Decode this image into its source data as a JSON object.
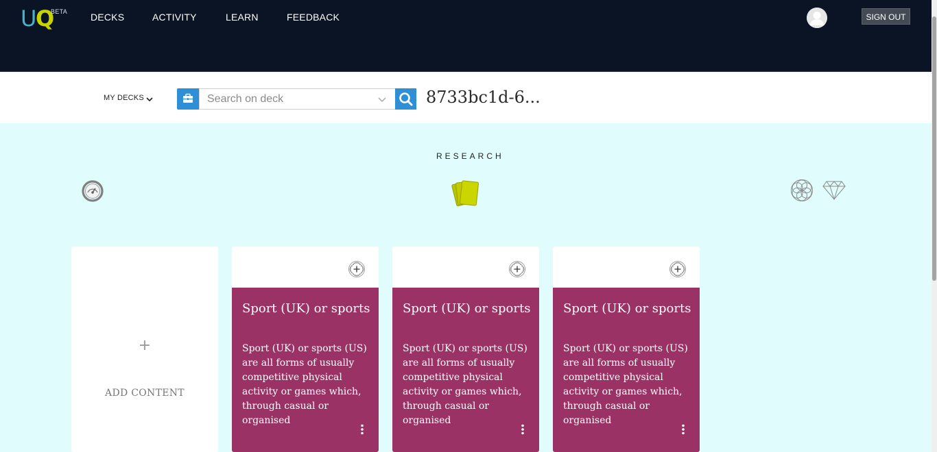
{
  "nav": {
    "logo_u": "U",
    "logo_q": "Q",
    "logo_beta": "BETA",
    "items": [
      {
        "label": "DECKS"
      },
      {
        "label": "ACTIVITY"
      },
      {
        "label": "LEARN"
      },
      {
        "label": "FEEDBACK"
      }
    ],
    "sign_out": "SIGN OUT",
    "avatar_icon": "user-avatar-icon"
  },
  "toolbar": {
    "my_decks": "MY DECKS",
    "search_placeholder": "Search on deck",
    "search_value": "",
    "deck_id": "8733bc1d-6..."
  },
  "research": {
    "title": "RESEARCH",
    "icons": [
      "gauge-icon",
      "cards-icon",
      "flower-icon",
      "diamond-icon"
    ]
  },
  "add_content": {
    "plus": "+",
    "label": "ADD CONTENT"
  },
  "cards": [
    {
      "title": "Sport (UK) or sports",
      "text": "Sport (UK) or sports (US) are all forms of usually competitive physical activity or games which, through casual or organised"
    },
    {
      "title": "Sport (UK) or sports",
      "text": "Sport (UK) or sports (US) are all forms of usually competitive physical activity or games which, through casual or organised"
    },
    {
      "title": "Sport (UK) or sports",
      "text": "Sport (UK) or sports (US) are all forms of usually competitive physical activity or games which, through casual or organised"
    }
  ],
  "colors": {
    "nav_bg": "#0b1424",
    "page_bg": "#e0fcfc",
    "accent_blue": "#2f8fd6",
    "card_magenta": "#9a3265",
    "logo_cyan": "#45b3c9",
    "logo_yellow": "#c8d400"
  }
}
